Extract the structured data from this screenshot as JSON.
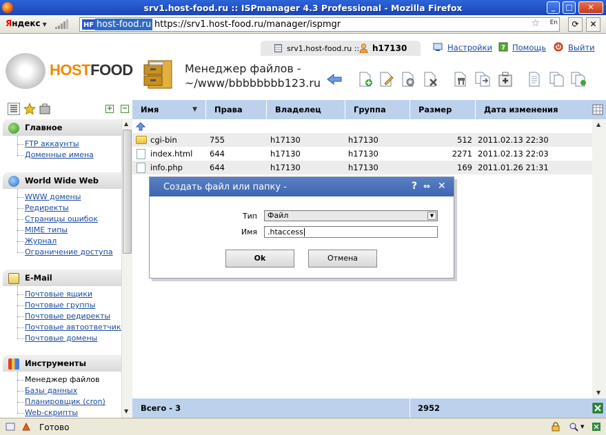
{
  "window": {
    "title": "srv1.host-food.ru :: ISPmanager 4.3 Professional - Mozilla Firefox",
    "minimize_label": "_",
    "maximize_label": "□",
    "close_label": "✕"
  },
  "navbar": {
    "yandex_y": "Я",
    "yandex_rest": "ндекс",
    "site_badge": "HF",
    "domain": "host-food.ru",
    "url_path": "https://srv1.host-food.ru/manager/ispmgr",
    "lang": "En",
    "go_label": "→",
    "refresh_label": "⟳",
    "stop_label": "✕"
  },
  "header": {
    "server": "srv1.host-food.ru ::",
    "user": "h17130",
    "settings_label": "Настройки",
    "help_label": "Помощь",
    "logout_label": "Выйти",
    "logo_host": "HOST",
    "logo_food": "FOOD",
    "title_line1": "Менеджер файлов -",
    "title_line2": "~/www/bbbbbbbb123.ru"
  },
  "sidebar": {
    "sections": [
      {
        "label": "Главное",
        "items": [
          "FTP аккаунты",
          "Доменные имена"
        ]
      },
      {
        "label": "World Wide Web",
        "items": [
          "WWW домены",
          "Редиректы",
          "Страницы ошибок",
          "MIME типы",
          "Журнал",
          "Ограничение доступа"
        ]
      },
      {
        "label": "E-Mail",
        "items": [
          "Почтовые ящики",
          "Почтовые группы",
          "Почтовые редиректы",
          "Почтовые автоответчики",
          "Почтовые домены"
        ]
      },
      {
        "label": "Инструменты",
        "items": [
          "Менеджер файлов",
          "Базы данных",
          "Планировщик (cron)",
          "Web-скрипты"
        ]
      }
    ]
  },
  "table": {
    "columns": [
      "Имя",
      "Права",
      "Владелец",
      "Группа",
      "Размер",
      "Дата изменения"
    ],
    "rows": [
      {
        "name": "cgi-bin",
        "type": "folder",
        "perms": "755",
        "owner": "h17130",
        "group": "h17130",
        "size": "512",
        "date": "2011.02.13 22:30"
      },
      {
        "name": "index.html",
        "type": "file",
        "perms": "644",
        "owner": "h17130",
        "group": "h17130",
        "size": "2271",
        "date": "2011.02.13 22:03"
      },
      {
        "name": "info.php",
        "type": "file",
        "perms": "644",
        "owner": "h17130",
        "group": "h17130",
        "size": "169",
        "date": "2011.01.26 21:31"
      }
    ],
    "footer_total": "Всего - 3",
    "footer_size": "2952"
  },
  "dialog": {
    "title": "Создать файл или папку -",
    "help_label": "?",
    "expand_label": "⇔",
    "close_label": "✕",
    "type_label": "Тип",
    "type_value": "Файл",
    "name_label": "Имя",
    "name_value": ".htaccess",
    "ok_label": "Ok",
    "cancel_label": "Отмена"
  },
  "statusbar": {
    "text": "Готово"
  },
  "colors": {
    "table_header": "#bcd2ec",
    "dialog_header": "#4a72ba",
    "link": "#1a4aa0",
    "logo_orange": "#f08a00"
  }
}
